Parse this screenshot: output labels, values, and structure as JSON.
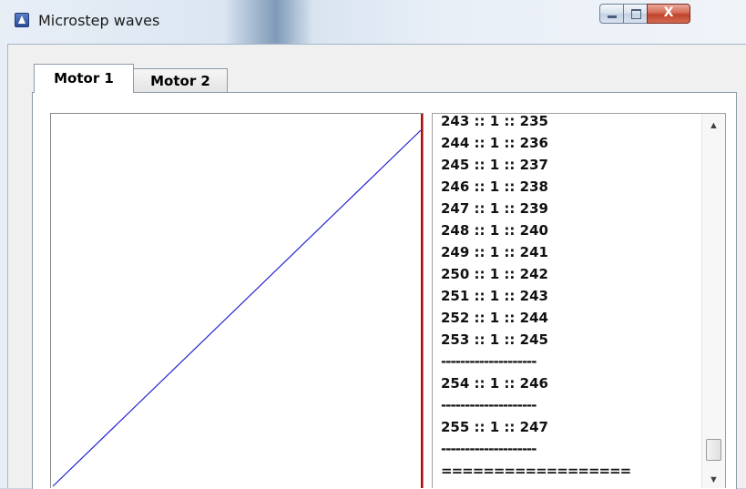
{
  "window": {
    "title": "Microstep waves",
    "close_glyph": "X"
  },
  "tabs": [
    {
      "label": "Motor 1",
      "active": true
    },
    {
      "label": "Motor 2",
      "active": false
    }
  ],
  "chart_data": {
    "type": "line",
    "title": "",
    "xlabel": "",
    "ylabel": "",
    "series": [
      {
        "x": [
          0,
          255
        ],
        "y": [
          0,
          255
        ],
        "color": "#2222cc"
      }
    ],
    "marker_color": "#cc0000",
    "grid": false
  },
  "list": {
    "rows": [
      {
        "kind": "row",
        "text": "243 :: 1 :: 235"
      },
      {
        "kind": "row",
        "text": "244 :: 1 :: 236"
      },
      {
        "kind": "row",
        "text": "245 :: 1 :: 237"
      },
      {
        "kind": "row",
        "text": "246 :: 1 :: 238"
      },
      {
        "kind": "row",
        "text": "247 :: 1 :: 239"
      },
      {
        "kind": "row",
        "text": "248 :: 1 :: 240"
      },
      {
        "kind": "row",
        "text": "249 :: 1 :: 241"
      },
      {
        "kind": "row",
        "text": "250 :: 1 :: 242"
      },
      {
        "kind": "row",
        "text": "251 :: 1 :: 243"
      },
      {
        "kind": "row",
        "text": "252 :: 1 :: 244"
      },
      {
        "kind": "row",
        "text": "253 :: 1 :: 245"
      },
      {
        "kind": "sep",
        "text": "--------------------"
      },
      {
        "kind": "row",
        "text": "254 :: 1 :: 246"
      },
      {
        "kind": "sep",
        "text": "--------------------"
      },
      {
        "kind": "row",
        "text": "255 :: 1 :: 247"
      },
      {
        "kind": "sep",
        "text": "--------------------"
      },
      {
        "kind": "sep",
        "text": "=================="
      }
    ],
    "scroll_up": "▲",
    "scroll_down": "▼"
  }
}
